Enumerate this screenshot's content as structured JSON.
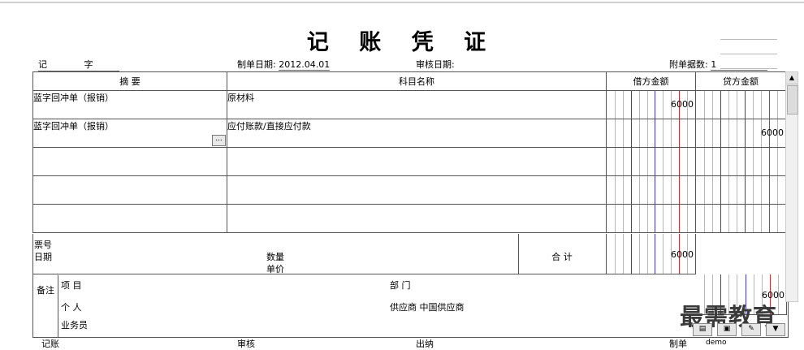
{
  "voucher": {
    "title": "记 账 凭 证",
    "type_label": "记",
    "number_label": "字",
    "date_label": "制单日期:",
    "date_value": "2012.04.01",
    "audit_date_label": "审核日期:",
    "attachments_label": "附单据数:",
    "attachments_value": "1"
  },
  "table": {
    "headers": [
      "摘 要",
      "科目名称",
      "借方金额",
      "贷方金额"
    ],
    "rows": [
      {
        "summary": "蓝字回冲单（报销）",
        "account": "原材料",
        "debit": "6000",
        "credit": ""
      },
      {
        "summary": "蓝字回冲单（报销）",
        "account": "应付账款/直接应付款",
        "debit": "",
        "credit": "6000"
      },
      {
        "summary": "",
        "account": "",
        "debit": "",
        "credit": ""
      },
      {
        "summary": "",
        "account": "",
        "debit": "",
        "credit": ""
      },
      {
        "summary": "",
        "account": "",
        "debit": "",
        "credit": ""
      }
    ],
    "ellipsis_label": "..."
  },
  "totals": {
    "ticket_label": "票号",
    "date_label": "日期",
    "quantity_label": "数量",
    "unit_label": "单价",
    "total_label": "合 计",
    "debit_total": "6000",
    "credit_total": "6000"
  },
  "remarks": {
    "label": "备注",
    "project_label": "项 目",
    "department_label": "部 门",
    "person_label": "个 人",
    "supplier_label": "供应商",
    "supplier_value": "中国供应商",
    "salesman_label": "业务员"
  },
  "signatures": {
    "bookkeeper_label": "记账",
    "auditor_label": "审核",
    "cashier_label": "出纳",
    "preparer_label": "制单",
    "preparer_value": "demo"
  },
  "watermark": "最需教育",
  "colors": {
    "grid_blue": "#3a3ad0",
    "grid_red": "#d03030",
    "grid_gray": "#b8b8b8"
  }
}
